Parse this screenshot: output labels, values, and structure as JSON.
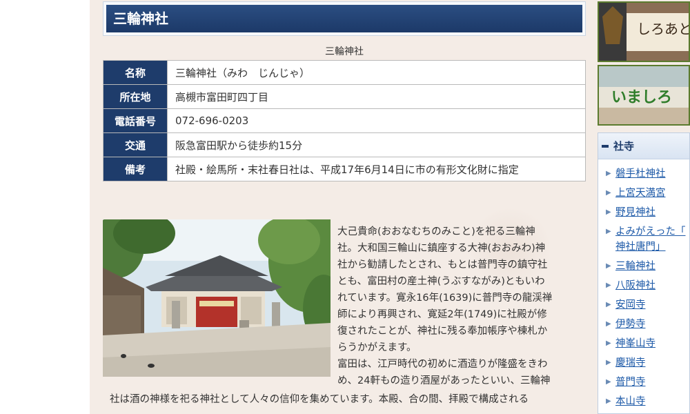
{
  "page": {
    "title": "三輪神社",
    "caption": "三輪神社"
  },
  "info_table": [
    {
      "label": "名称",
      "value": "三輪神社（みわ　じんじゃ）"
    },
    {
      "label": "所在地",
      "value": "高槻市富田町四丁目"
    },
    {
      "label": "電話番号",
      "value": "072-696-0203"
    },
    {
      "label": "交通",
      "value": "阪急富田駅から徒歩約15分"
    },
    {
      "label": "備考",
      "value": "社殿・絵馬所・末社春日社は、平成17年6月14日に市の有形文化財に指定"
    }
  ],
  "article": {
    "lines_right": [
      "大己貴命(おおなむちのみこと)を祀る三輪神",
      "社。大和国三輪山に鎮座する大神(おおみわ)神",
      "社から勧請したとされ、もとは普門寺の鎮守社",
      "とも、富田村の産土神(うぶすながみ)ともいわ",
      "れています。寛永16年(1639)に普門寺の龍渓禅",
      "師により再興され、寛延2年(1749)に社殿が修",
      "復されたことが、神社に残る奉加帳序や棟札か",
      "らうかがえます。",
      "富田は、江戸時代の初めに酒造りが隆盛をきわ",
      "め、24軒もの造り酒屋があったといい、三輪神"
    ],
    "line_wide": "社は酒の神様を祀る神社として人々の信仰を集めています。本殿、合の間、拝殿で構成される"
  },
  "sidebar": {
    "banner1_text": "しろあと歴史館",
    "banner2_text": "いましろ",
    "section_title": "社寺",
    "items": [
      "磐手杜神社",
      "上宮天満宮",
      "野見神社",
      "よみがえった「",
      "三輪神社",
      "八阪神社",
      "安岡寺",
      "伊勢寺",
      "神峯山寺",
      "慶瑞寺",
      "普門寺",
      "本山寺"
    ],
    "item4_line2": "神社唐門」"
  },
  "colors": {
    "title_bar": "#1e3c6b",
    "table_header": "#1e3c6b",
    "link": "#1e5aa8",
    "page_bg": "#f4ece6"
  }
}
